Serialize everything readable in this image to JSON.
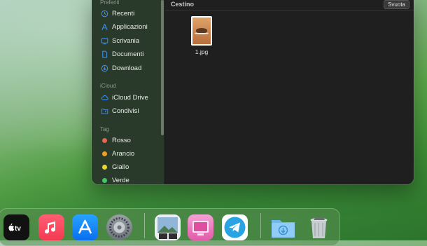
{
  "finder": {
    "sidebar": {
      "preferiti_header": "Preferiti",
      "preferiti": [
        {
          "label": "Recenti",
          "icon": "clock-icon"
        },
        {
          "label": "Applicazioni",
          "icon": "applications-icon"
        },
        {
          "label": "Scrivania",
          "icon": "desktop-icon"
        },
        {
          "label": "Documenti",
          "icon": "document-icon"
        },
        {
          "label": "Download",
          "icon": "download-icon"
        }
      ],
      "icloud_header": "iCloud",
      "icloud": [
        {
          "label": "iCloud Drive",
          "icon": "cloud-icon"
        },
        {
          "label": "Condivisi",
          "icon": "shared-folder-icon"
        }
      ],
      "tag_header": "Tag",
      "tags": [
        {
          "label": "Rosso",
          "color": "#e8664f"
        },
        {
          "label": "Arancio",
          "color": "#e9a12a"
        },
        {
          "label": "Giallo",
          "color": "#e8d92c"
        },
        {
          "label": "Verde",
          "color": "#46c46a"
        }
      ]
    },
    "content": {
      "title": "Cestino",
      "empty_button": "Svuota",
      "files": [
        {
          "name": "1.jpg"
        }
      ]
    }
  },
  "dock": {
    "apps": [
      {
        "name": "Apple TV",
        "badge": "tv"
      },
      {
        "name": "Musica"
      },
      {
        "name": "App Store"
      },
      {
        "name": "Impostazioni di Sistema"
      },
      {
        "name": "Anteprima"
      },
      {
        "name": "CleanMyMac"
      },
      {
        "name": "Telegram"
      },
      {
        "name": "Download"
      },
      {
        "name": "Cestino"
      }
    ]
  },
  "colors": {
    "accent": "#3b8cf0",
    "finder_bg": "#1f1f1f",
    "sidebar_bg": "#2a3a2a"
  }
}
